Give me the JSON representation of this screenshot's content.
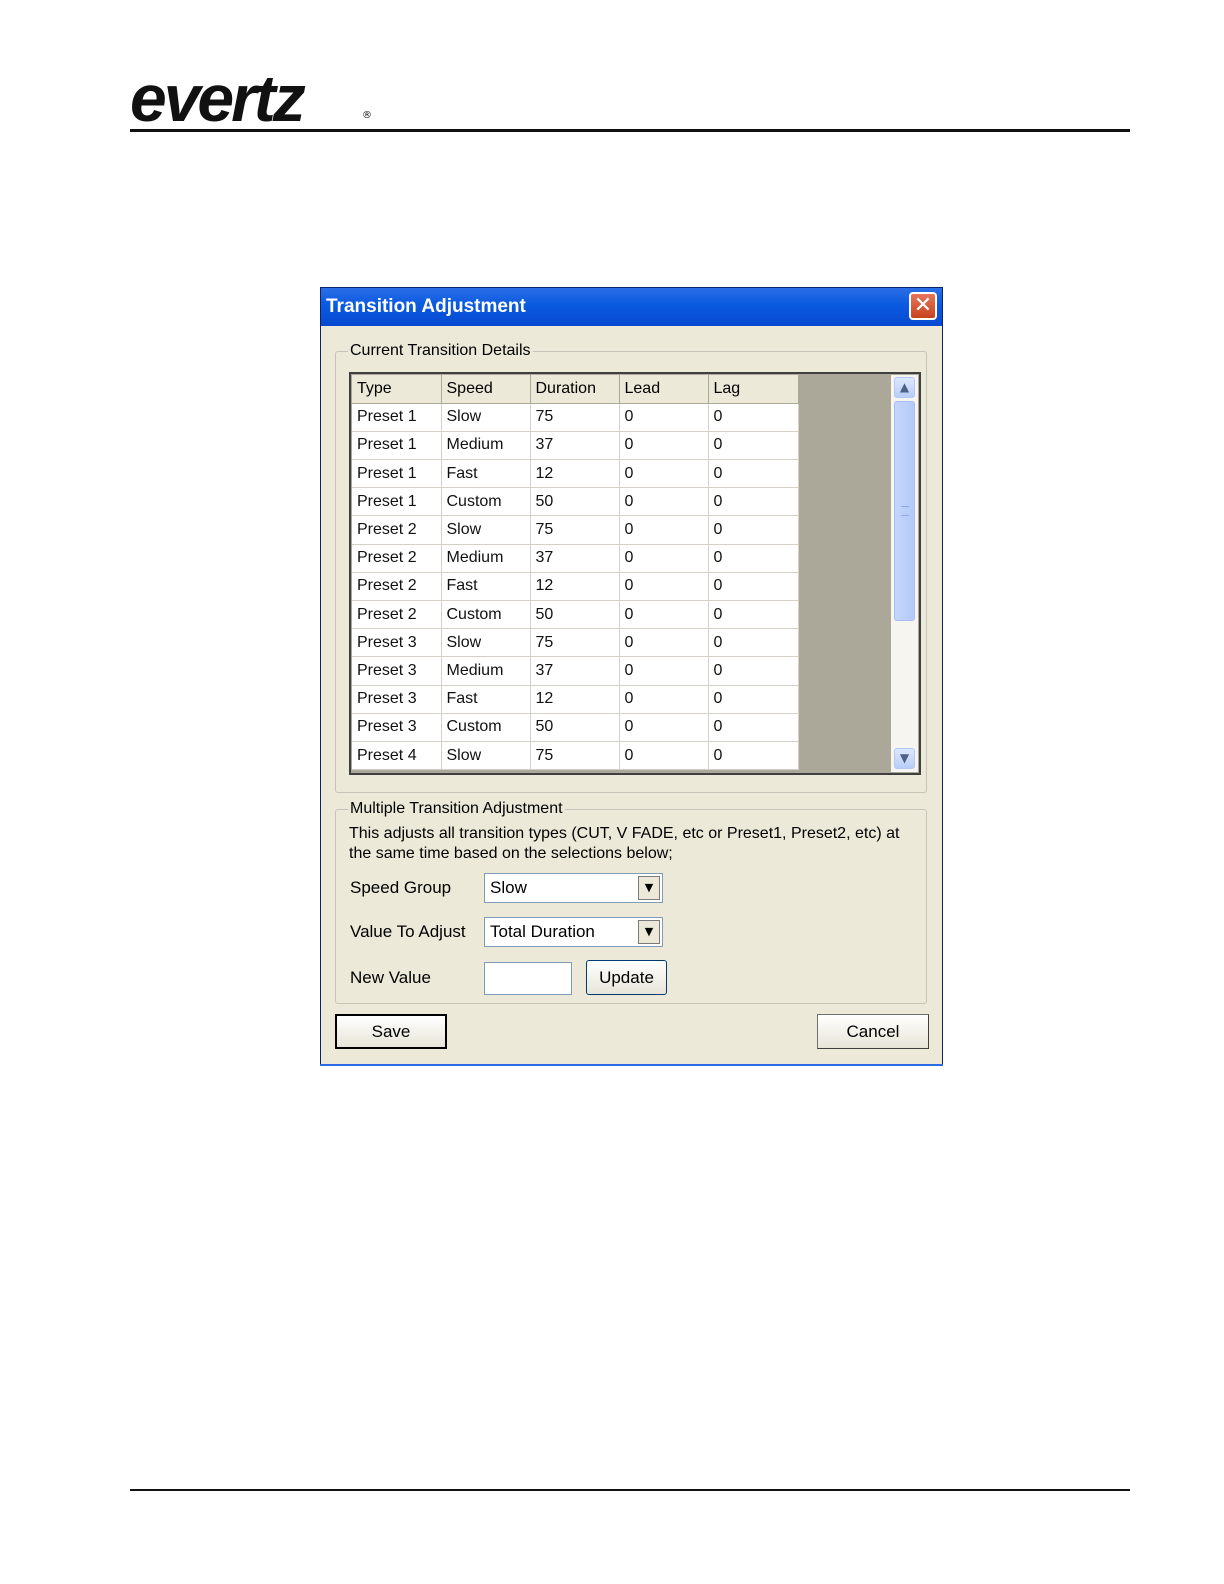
{
  "logo": {
    "text": "evertz",
    "registered": "®"
  },
  "dialog": {
    "title": "Transition Adjustment",
    "close_glyph": "✕",
    "current_group": {
      "title": "Current Transition Details",
      "columns": [
        "Type",
        "Speed",
        "Duration",
        "Lead",
        "Lag"
      ],
      "rows": [
        [
          "Preset 1",
          "Slow",
          "75",
          "0",
          "0"
        ],
        [
          "Preset 1",
          "Medium",
          "37",
          "0",
          "0"
        ],
        [
          "Preset 1",
          "Fast",
          "12",
          "0",
          "0"
        ],
        [
          "Preset 1",
          "Custom",
          "50",
          "0",
          "0"
        ],
        [
          "Preset 2",
          "Slow",
          "75",
          "0",
          "0"
        ],
        [
          "Preset 2",
          "Medium",
          "37",
          "0",
          "0"
        ],
        [
          "Preset 2",
          "Fast",
          "12",
          "0",
          "0"
        ],
        [
          "Preset 2",
          "Custom",
          "50",
          "0",
          "0"
        ],
        [
          "Preset 3",
          "Slow",
          "75",
          "0",
          "0"
        ],
        [
          "Preset 3",
          "Medium",
          "37",
          "0",
          "0"
        ],
        [
          "Preset 3",
          "Fast",
          "12",
          "0",
          "0"
        ],
        [
          "Preset 3",
          "Custom",
          "50",
          "0",
          "0"
        ],
        [
          "Preset 4",
          "Slow",
          "75",
          "0",
          "0"
        ]
      ],
      "scroll_up_glyph": "▲",
      "scroll_down_glyph": "▼"
    },
    "multiple_group": {
      "title": "Multiple Transition Adjustment",
      "description": "This adjusts all transition types (CUT, V FADE, etc or Preset1, Preset2, etc) at the same time based on the selections below;",
      "speed_group_label": "Speed Group",
      "speed_group_value": "Slow",
      "value_to_adjust_label": "Value To Adjust",
      "value_to_adjust_value": "Total Duration",
      "new_value_label": "New Value",
      "new_value_input": "",
      "update_label": "Update",
      "dropdown_glyph": "▼"
    },
    "save_label": "Save",
    "cancel_label": "Cancel"
  }
}
